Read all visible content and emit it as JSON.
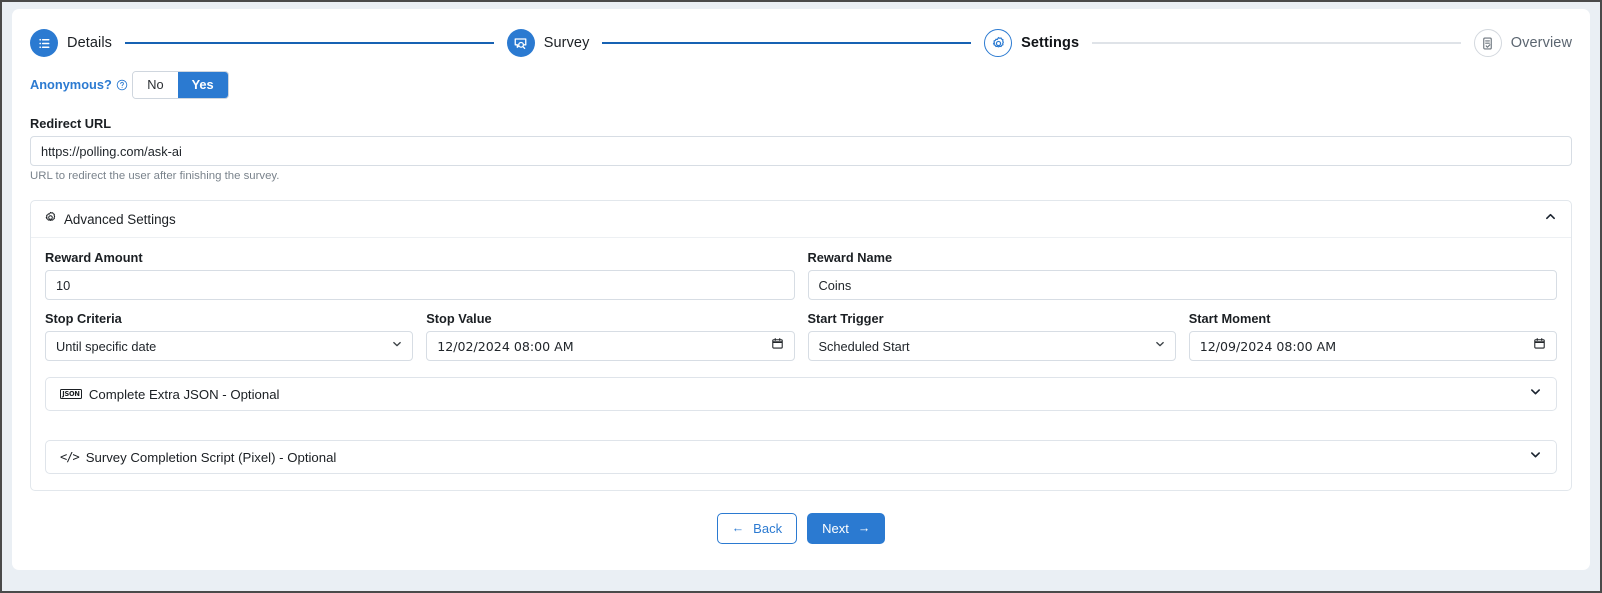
{
  "stepper": {
    "steps": [
      {
        "label": "Details",
        "icon": "list-icon",
        "state": "done"
      },
      {
        "label": "Survey",
        "icon": "survey-search-icon",
        "state": "done"
      },
      {
        "label": "Settings",
        "icon": "gear-icon",
        "state": "active"
      },
      {
        "label": "Overview",
        "icon": "clipboard-check-icon",
        "state": "todo"
      }
    ]
  },
  "anonymous": {
    "label": "Anonymous?",
    "help_icon": "question-circle-icon",
    "options": [
      "No",
      "Yes"
    ],
    "selected": "Yes"
  },
  "redirect": {
    "label": "Redirect URL",
    "value": "https://polling.com/ask-ai",
    "hint": "URL to redirect the user after finishing the survey."
  },
  "advanced": {
    "title": "Advanced Settings",
    "icon": "gear-icon",
    "toggle_icon": "chevron-up-icon",
    "expanded": true,
    "fields": {
      "reward_amount": {
        "label": "Reward Amount",
        "value": "10"
      },
      "reward_name": {
        "label": "Reward Name",
        "value": "Coins"
      },
      "stop_criteria": {
        "label": "Stop Criteria",
        "value": "Until specific date",
        "options": [
          "Until specific date"
        ]
      },
      "stop_value": {
        "label": "Stop Value",
        "value": "12/02/2024 08:00 AM"
      },
      "start_trigger": {
        "label": "Start Trigger",
        "value": "Scheduled Start",
        "options": [
          "Scheduled Start"
        ]
      },
      "start_moment": {
        "label": "Start Moment",
        "value": "12/09/2024 08:00 AM"
      }
    },
    "sub_panels": [
      {
        "label": "Complete Extra JSON - Optional",
        "icon": "json-badge-icon",
        "toggle_icon": "chevron-down-icon"
      },
      {
        "label": "Survey Completion Script (Pixel) - Optional",
        "icon": "code-icon",
        "toggle_icon": "chevron-down-icon"
      }
    ]
  },
  "footer": {
    "back": {
      "label": "Back",
      "arrow": "←"
    },
    "next": {
      "label": "Next",
      "arrow": "→"
    }
  },
  "colors": {
    "accent": "#2b7ad1",
    "connector_done": "#1762b3",
    "connector_todo": "#dfe3e8",
    "page_bg": "#eaeff4"
  }
}
